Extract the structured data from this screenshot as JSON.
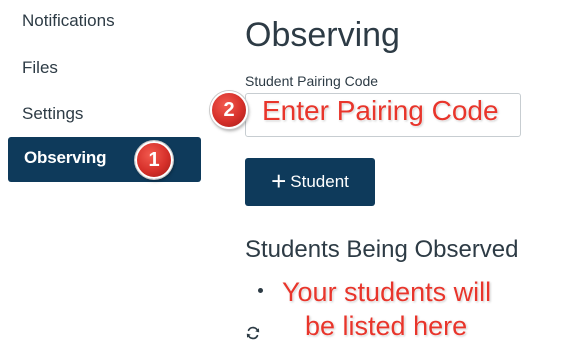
{
  "sidebar": {
    "items": [
      {
        "label": "Notifications"
      },
      {
        "label": "Files"
      },
      {
        "label": "Settings"
      },
      {
        "label": "Observing",
        "active": true
      }
    ]
  },
  "main": {
    "title": "Observing",
    "pairing": {
      "label": "Student Pairing Code",
      "value": "",
      "placeholder": ""
    },
    "add_button": {
      "icon": "plus-icon",
      "label": "Student"
    },
    "students_section": {
      "title": "Students Being Observed",
      "refresh_icon": "refresh-icon"
    }
  },
  "annotations": {
    "step1_badge": "1",
    "step2_badge": "2",
    "step2_text": "Enter  Pairing Code",
    "students_note_line1": "Your students will",
    "students_note_line2": "be listed here"
  },
  "colors": {
    "primary": "#0e3a5b",
    "text": "#2d3b45",
    "annotation": "#e8352b",
    "input_border": "#c7cdd1"
  }
}
